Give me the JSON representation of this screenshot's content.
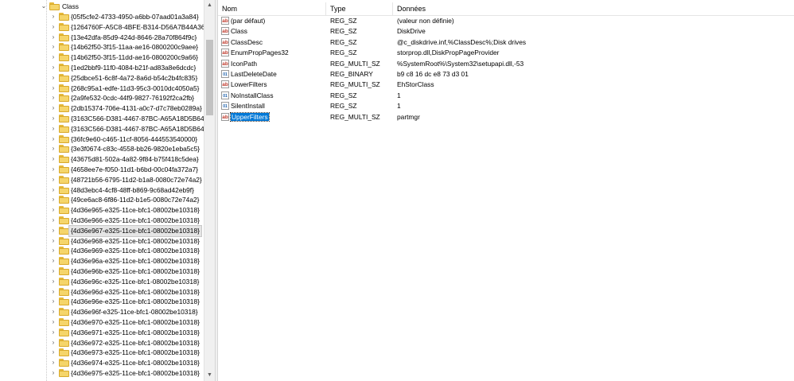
{
  "tree": {
    "root_label": "Class",
    "items": [
      "{05f5cfe2-4733-4950-a6bb-07aad01a3a84}",
      "{1264760F-A5C8-4BFE-B314-D56A7B44A362}",
      "{13e42dfa-85d9-424d-8646-28a70f864f9c}",
      "{14b62f50-3f15-11aa-ae16-0800200c9aee}",
      "{14b62f50-3f15-11dd-ae16-0800200c9a66}",
      "{1ed2bbf9-11f0-4084-b21f-ad83a8e6dcdc}",
      "{25dbce51-6c8f-4a72-8a6d-b54c2b4fc835}",
      "{268c95a1-edfe-11d3-95c3-0010dc4050a5}",
      "{2a9fe532-0cdc-44f9-9827-76192f2ca2fb}",
      "{2db15374-706e-4131-a0c7-d7c78eb0289a}",
      "{3163C566-D381-4467-87BC-A65A18D5B648}",
      "{3163C566-D381-4467-87BC-A65A18D5B649}",
      "{36fc9e60-c465-11cf-8056-444553540000}",
      "{3e3f0674-c83c-4558-bb26-9820e1eba5c5}",
      "{43675d81-502a-4a82-9f84-b75f418c5dea}",
      "{4658ee7e-f050-11d1-b6bd-00c04fa372a7}",
      "{48721b56-6795-11d2-b1a8-0080c72e74a2}",
      "{48d3ebc4-4cf8-48ff-b869-9c68ad42eb9f}",
      "{49ce6ac8-6f86-11d2-b1e5-0080c72e74a2}",
      "{4d36e965-e325-11ce-bfc1-08002be10318}",
      "{4d36e966-e325-11ce-bfc1-08002be10318}",
      "{4d36e967-e325-11ce-bfc1-08002be10318}",
      "{4d36e968-e325-11ce-bfc1-08002be10318}",
      "{4d36e969-e325-11ce-bfc1-08002be10318}",
      "{4d36e96a-e325-11ce-bfc1-08002be10318}",
      "{4d36e96b-e325-11ce-bfc1-08002be10318}",
      "{4d36e96c-e325-11ce-bfc1-08002be10318}",
      "{4d36e96d-e325-11ce-bfc1-08002be10318}",
      "{4d36e96e-e325-11ce-bfc1-08002be10318}",
      "{4d36e96f-e325-11ce-bfc1-08002be10318}",
      "{4d36e970-e325-11ce-bfc1-08002be10318}",
      "{4d36e971-e325-11ce-bfc1-08002be10318}",
      "{4d36e972-e325-11ce-bfc1-08002be10318}",
      "{4d36e973-e325-11ce-bfc1-08002be10318}",
      "{4d36e974-e325-11ce-bfc1-08002be10318}",
      "{4d36e975-e325-11ce-bfc1-08002be10318}"
    ],
    "selected_item": "{4d36e967-e325-11ce-bfc1-08002be10318}"
  },
  "values": {
    "headers": {
      "name": "Nom",
      "type": "Type",
      "data": "Données"
    },
    "rows": [
      {
        "icon": "string-value-icon",
        "name": "(par défaut)",
        "type": "REG_SZ",
        "data": "(valeur non définie)"
      },
      {
        "icon": "string-value-icon",
        "name": "Class",
        "type": "REG_SZ",
        "data": "DiskDrive"
      },
      {
        "icon": "string-value-icon",
        "name": "ClassDesc",
        "type": "REG_SZ",
        "data": "@c_diskdrive.inf,%ClassDesc%;Disk drives"
      },
      {
        "icon": "string-value-icon",
        "name": "EnumPropPages32",
        "type": "REG_SZ",
        "data": "storprop.dll,DiskPropPageProvider"
      },
      {
        "icon": "string-value-icon",
        "name": "IconPath",
        "type": "REG_MULTI_SZ",
        "data": "%SystemRoot%\\System32\\setupapi.dll,-53"
      },
      {
        "icon": "binary-value-icon",
        "name": "LastDeleteDate",
        "type": "REG_BINARY",
        "data": "b9 c8 16 dc e8 73 d3 01"
      },
      {
        "icon": "string-value-icon",
        "name": "LowerFilters",
        "type": "REG_MULTI_SZ",
        "data": "EhStorClass"
      },
      {
        "icon": "binary-value-icon",
        "name": "NoInstallClass",
        "type": "REG_SZ",
        "data": "1"
      },
      {
        "icon": "binary-value-icon",
        "name": "SilentInstall",
        "type": "REG_SZ",
        "data": "1"
      },
      {
        "icon": "string-value-icon",
        "name": "UpperFilters",
        "type": "REG_MULTI_SZ",
        "data": "partmgr"
      }
    ],
    "selected_row": "UpperFilters"
  },
  "scrollbar": {
    "up_glyph": "▲",
    "down_glyph": "▼"
  },
  "colors": {
    "selection": "#0078d7",
    "folder": "#f5d56a"
  }
}
